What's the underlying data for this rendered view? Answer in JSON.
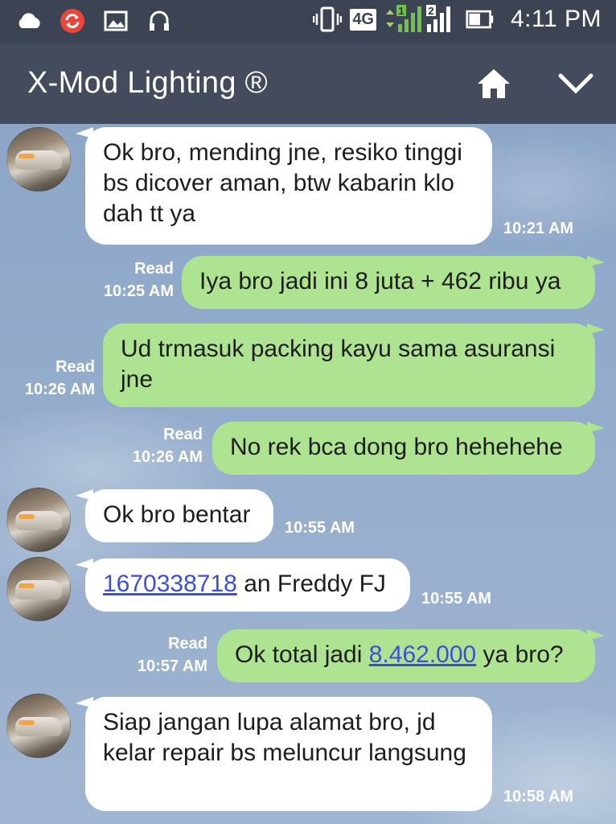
{
  "status_bar": {
    "time": "4:11 PM",
    "network": "4G",
    "sim1": "1",
    "sim2": "2"
  },
  "header": {
    "title": "X-Mod Lighting ®"
  },
  "messages": [
    {
      "dir": "in",
      "text": "Ok bro, mending jne, resiko tinggi bs dicover aman, btw kabarin klo dah tt ya",
      "time": "10:21 AM"
    },
    {
      "dir": "out",
      "text": "Iya bro jadi ini 8 juta + 462 ribu ya",
      "status": "Read",
      "time": "10:25 AM"
    },
    {
      "dir": "out",
      "text": "Ud trmasuk packing kayu sama asuransi jne",
      "status": "Read",
      "time": "10:26 AM"
    },
    {
      "dir": "out",
      "text": "No rek bca dong bro hehehehe",
      "status": "Read",
      "time": "10:26 AM"
    },
    {
      "dir": "in",
      "text": "Ok bro bentar",
      "time": "10:55 AM"
    },
    {
      "dir": "in",
      "link": "1670338718",
      "text_after": " an Freddy FJ",
      "time": "10:55 AM"
    },
    {
      "dir": "out",
      "text_before": "Ok total jadi ",
      "link": "8.462.000",
      "text_after": " ya bro?",
      "status": "Read",
      "time": "10:57 AM"
    },
    {
      "dir": "in",
      "text": "Siap jangan lupa alamat bro, jd kelar repair bs meluncur langsung",
      "time": "10:58 AM"
    }
  ],
  "colors": {
    "header_bg": "#434b5c",
    "status_bg": "#3c4453",
    "bubble_in": "#ffffff",
    "bubble_out": "#aee491",
    "link": "#3d4fd6"
  },
  "icons": [
    "cloud-icon",
    "sync-icon",
    "image-icon",
    "headset-icon",
    "vibrate-icon",
    "signal-icon",
    "battery-icon",
    "home-icon",
    "chevron-down-icon"
  ]
}
